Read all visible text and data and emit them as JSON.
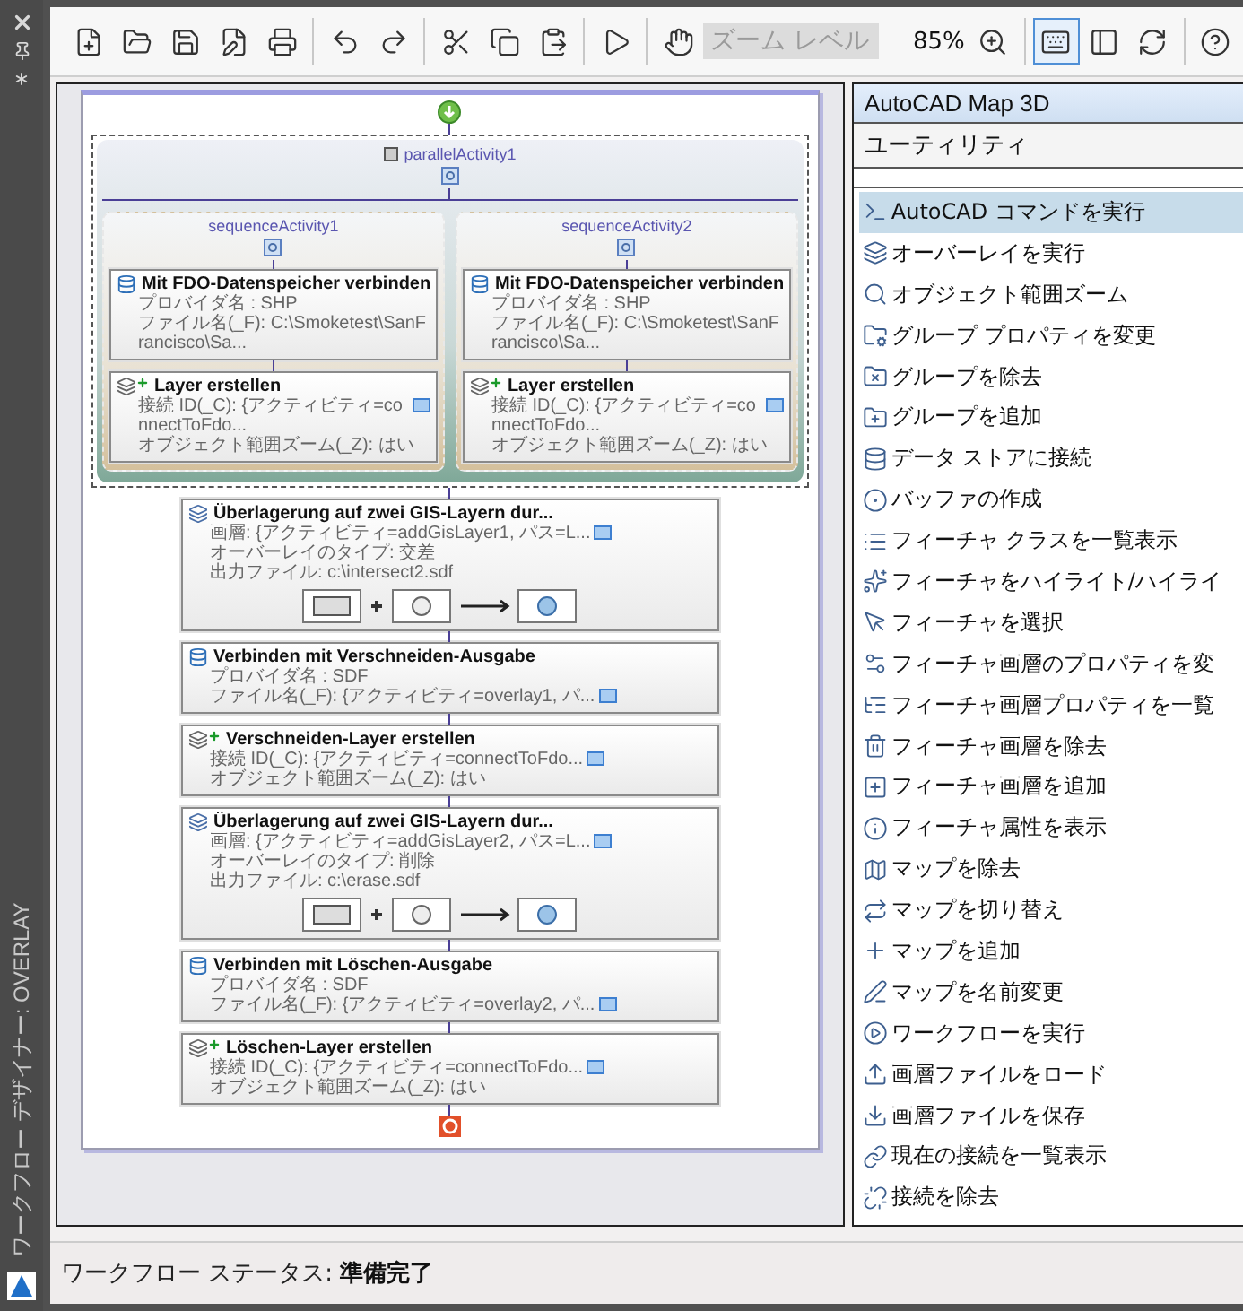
{
  "designer": {
    "title": "ワークフロー デザイナー: OVERLAY"
  },
  "toolbar": {
    "groups": [
      {
        "items": [
          {
            "kind": "button",
            "selected": false
          },
          {
            "kind": "button",
            "selected": false
          },
          {
            "kind": "button",
            "selected": false
          },
          {
            "kind": "button",
            "selected": false
          },
          {
            "kind": "button",
            "selected": false
          }
        ]
      },
      {
        "items": [
          {
            "kind": "button",
            "selected": false
          },
          {
            "kind": "button",
            "selected": false
          }
        ]
      },
      {
        "items": [
          {
            "kind": "button",
            "selected": false
          },
          {
            "kind": "button",
            "selected": false
          },
          {
            "kind": "button",
            "selected": false
          }
        ]
      },
      {
        "items": [
          {
            "kind": "button",
            "selected": false
          }
        ]
      },
      {
        "items": [
          {
            "kind": "button",
            "selected": false
          },
          {
            "kind": "zoom-field",
            "placeholder": "ズーム レベル",
            "disabled": true
          },
          {
            "kind": "zoom-value",
            "value": "85%"
          },
          {
            "kind": "button",
            "selected": false
          }
        ]
      },
      {
        "items": [
          {
            "kind": "button",
            "selected": true
          },
          {
            "kind": "button",
            "selected": false
          },
          {
            "kind": "button",
            "selected": false
          }
        ]
      },
      {
        "items": [
          {
            "kind": "button",
            "selected": false
          }
        ]
      }
    ]
  },
  "workflow": {
    "parallel": {
      "title": "parallelActivity1",
      "branches": [
        {
          "title": "sequenceActivity1",
          "activities": [
            {
              "kind": "connect",
              "title": "Mit FDO-Datenspeicher verbinden",
              "props": [
                {
                  "text": "プロバイダ名 : SHP",
                  "browse": false
                },
                {
                  "text": "ファイル名(_F): C:\\Smoketest\\SanFrancisco\\Sa...",
                  "browse": false
                }
              ]
            },
            {
              "kind": "layer",
              "title": "Layer erstellen",
              "props": [
                {
                  "text": "接続 ID(_C): {アクティビティ=connectToFdo...",
                  "browse": true
                },
                {
                  "text": "オブジェクト範囲ズーム(_Z): はい",
                  "browse": false
                }
              ]
            }
          ]
        },
        {
          "title": "sequenceActivity2",
          "activities": [
            {
              "kind": "connect",
              "title": "Mit FDO-Datenspeicher verbinden",
              "props": [
                {
                  "text": "プロバイダ名 : SHP",
                  "browse": false
                },
                {
                  "text": "ファイル名(_F): C:\\Smoketest\\SanFrancisco\\Sa...",
                  "browse": false
                }
              ]
            },
            {
              "kind": "layer",
              "title": "Layer erstellen",
              "props": [
                {
                  "text": "接続 ID(_C): {アクティビティ=connectToFdo...",
                  "browse": true
                },
                {
                  "text": "オブジェクト範囲ズーム(_Z): はい",
                  "browse": false
                }
              ]
            }
          ]
        }
      ]
    },
    "activities": [
      {
        "kind": "overlay",
        "title": "Überlagerung auf zwei GIS-Layern dur...",
        "props": [
          {
            "text": "画層: {アクティビティ=addGisLayer1, パス=L...",
            "browse": true
          },
          {
            "text": "オーバーレイのタイプ: 交差",
            "browse": false
          },
          {
            "text": "出力ファイル: c:\\intersect2.sdf",
            "browse": false
          }
        ]
      },
      {
        "kind": "connect",
        "title": "Verbinden mit Verschneiden-Ausgabe",
        "props": [
          {
            "text": "プロバイダ名 : SDF",
            "browse": false
          },
          {
            "text": "ファイル名(_F): {アクティビティ=overlay1, パ...",
            "browse": true
          }
        ]
      },
      {
        "kind": "layer",
        "title": "Verschneiden-Layer erstellen",
        "props": [
          {
            "text": "接続 ID(_C): {アクティビティ=connectToFdo...",
            "browse": true
          },
          {
            "text": "オブジェクト範囲ズーム(_Z): はい",
            "browse": false
          }
        ]
      },
      {
        "kind": "overlay",
        "title": "Überlagerung auf zwei GIS-Layern dur...",
        "props": [
          {
            "text": "画層: {アクティビティ=addGisLayer2, パス=L...",
            "browse": true
          },
          {
            "text": "オーバーレイのタイプ: 削除",
            "browse": false
          },
          {
            "text": "出力ファイル: c:\\erase.sdf",
            "browse": false
          }
        ]
      },
      {
        "kind": "connect",
        "title": "Verbinden mit Löschen-Ausgabe",
        "props": [
          {
            "text": "プロバイダ名 : SDF",
            "browse": false
          },
          {
            "text": "ファイル名(_F): {アクティビティ=overlay2, パ...",
            "browse": true
          }
        ]
      },
      {
        "kind": "layer",
        "title": "Löschen-Layer erstellen",
        "props": [
          {
            "text": "接続 ID(_C): {アクティビティ=connectToFdo...",
            "browse": true
          },
          {
            "text": "オブジェクト範囲ズーム(_Z): はい",
            "browse": false
          }
        ]
      }
    ]
  },
  "panel": {
    "title": "AutoCAD Map 3D",
    "category": "ユーティリティ",
    "items": [
      {
        "label": "AutoCAD コマンドを実行",
        "selected": true
      },
      {
        "label": "オーバーレイを実行",
        "selected": false
      },
      {
        "label": "オブジェクト範囲ズーム",
        "selected": false
      },
      {
        "label": "グループ プロパティを変更",
        "selected": false
      },
      {
        "label": "グループを除去",
        "selected": false
      },
      {
        "label": "グループを追加",
        "selected": false
      },
      {
        "label": "データ ストアに接続",
        "selected": false
      },
      {
        "label": "バッファの作成",
        "selected": false
      },
      {
        "label": "フィーチャ クラスを一覧表示",
        "selected": false
      },
      {
        "label": "フィーチャをハイライト/ハイライ",
        "selected": false
      },
      {
        "label": "フィーチャを選択",
        "selected": false
      },
      {
        "label": "フィーチャ画層のプロパティを変",
        "selected": false
      },
      {
        "label": "フィーチャ画層プロパティを一覧",
        "selected": false
      },
      {
        "label": "フィーチャ画層を除去",
        "selected": false
      },
      {
        "label": "フィーチャ画層を追加",
        "selected": false
      },
      {
        "label": "フィーチャ属性を表示",
        "selected": false
      },
      {
        "label": "マップを除去",
        "selected": false
      },
      {
        "label": "マップを切り替え",
        "selected": false
      },
      {
        "label": "マップを追加",
        "selected": false
      },
      {
        "label": "マップを名前変更",
        "selected": false
      },
      {
        "label": "ワークフローを実行",
        "selected": false
      },
      {
        "label": "画層ファイルをロード",
        "selected": false
      },
      {
        "label": "画層ファイルを保存",
        "selected": false
      },
      {
        "label": "現在の接続を一覧表示",
        "selected": false
      },
      {
        "label": "接続を除去",
        "selected": false
      }
    ]
  },
  "status_bar": {
    "label": "ワークフロー ステータス:",
    "value": "準備完了"
  }
}
